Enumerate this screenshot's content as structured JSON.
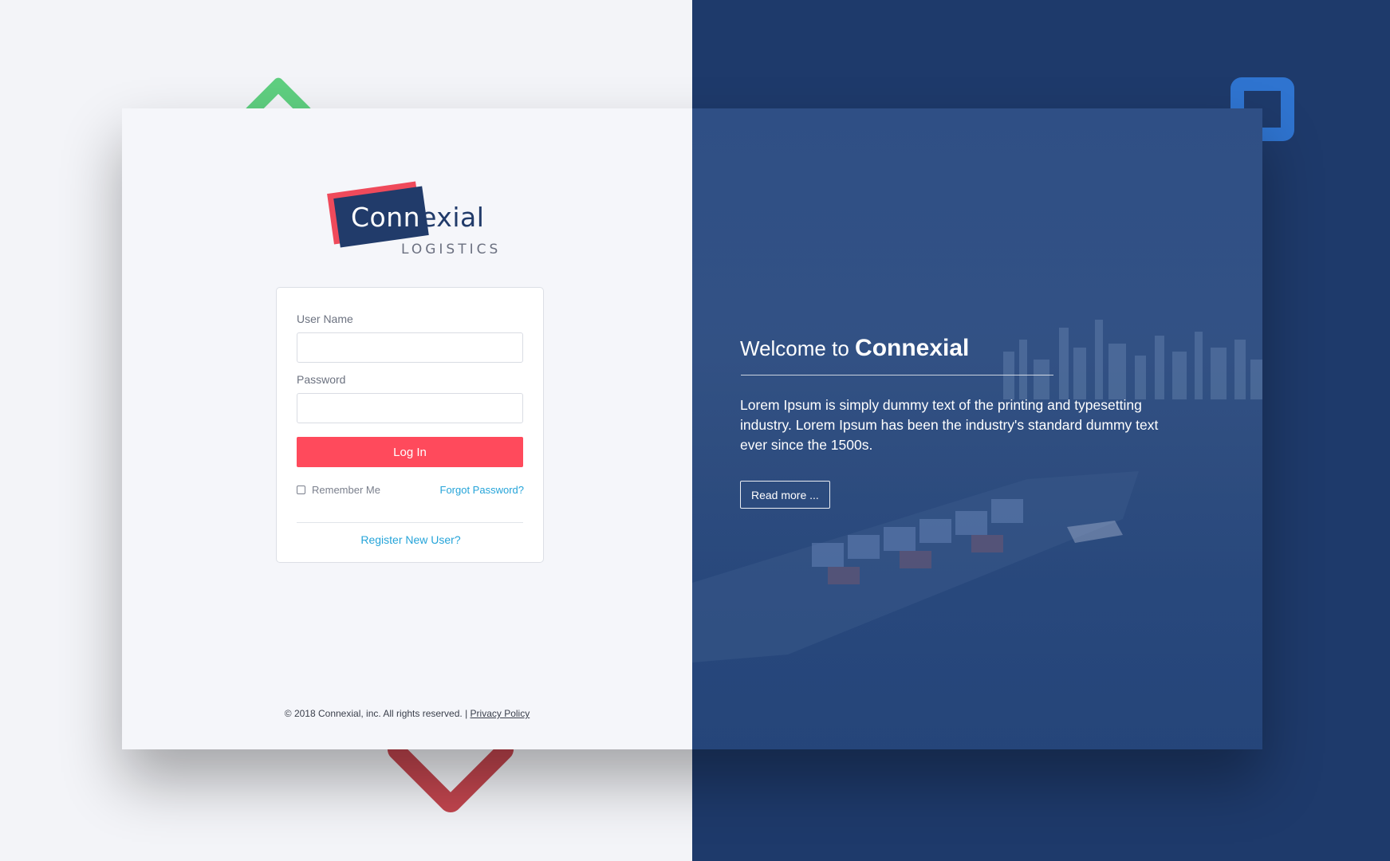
{
  "logo": {
    "name_part1": "Conn",
    "name_part2": "exial",
    "subtitle": "LOGISTICS"
  },
  "login": {
    "username_label": "User Name",
    "username_value": "",
    "password_label": "Password",
    "password_value": "",
    "login_button": "Log In",
    "remember_label": "Remember Me",
    "forgot_link": "Forgot Password?",
    "register_link": "Register New User?"
  },
  "footer": {
    "copyright": "© 2018 Connexial, inc. All rights reserved. |",
    "privacy_link": "Privacy Policy"
  },
  "hero": {
    "welcome_prefix": "Welcome to",
    "welcome_brand": "Connexial",
    "description": "Lorem Ipsum is simply dummy text of the printing and typesetting industry. Lorem Ipsum has been the industry's standard dummy text ever since the 1500s.",
    "read_more": "Read more ..."
  },
  "colors": {
    "accent": "#ff4a5c",
    "navy": "#213b6a",
    "link": "#25a4d9",
    "background_right": "#1e3a6b"
  }
}
